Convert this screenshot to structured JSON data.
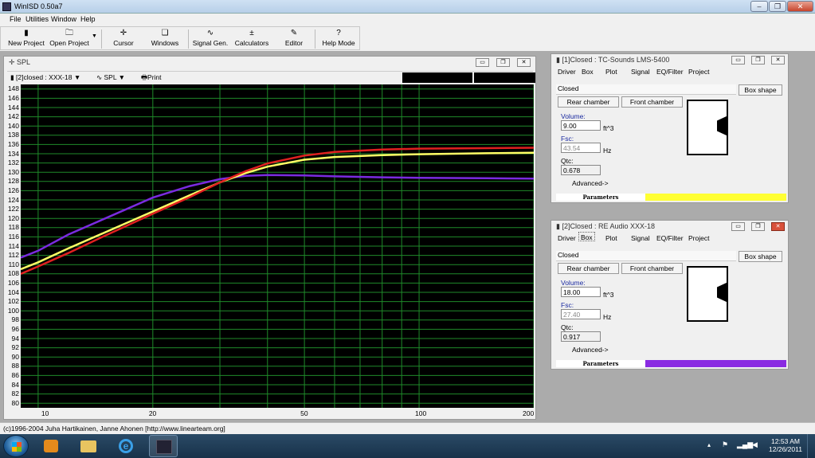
{
  "window": {
    "title": "WinISD 0.50a7"
  },
  "menu": [
    "File",
    "Utilities",
    "Window",
    "Help"
  ],
  "toolbar": [
    {
      "label": "New Project",
      "icon": "new-project-icon"
    },
    {
      "label": "Open Project",
      "icon": "open-folder-icon"
    },
    {
      "label": "Cursor",
      "icon": "cursor-icon"
    },
    {
      "label": "Windows",
      "icon": "windows-icon"
    },
    {
      "label": "Signal Gen.",
      "icon": "sine-wave-icon"
    },
    {
      "label": "Calculators",
      "icon": "calculator-icon"
    },
    {
      "label": "Editor",
      "icon": "editor-icon"
    },
    {
      "label": "Help Mode",
      "icon": "help-icon"
    }
  ],
  "spl_window": {
    "title": "SPL",
    "project_select": "[2]closed : XXX-18",
    "graph_select": "SPL",
    "print_label": "Print"
  },
  "chart_data": {
    "type": "line",
    "title": "",
    "xlabel": "",
    "ylabel": "",
    "x_scale": "log",
    "xlim": [
      9,
      200
    ],
    "ylim": [
      79,
      149
    ],
    "x_ticks": [
      10,
      20,
      50,
      100,
      200
    ],
    "y_ticks": [
      80,
      82,
      84,
      86,
      88,
      90,
      92,
      94,
      96,
      98,
      100,
      102,
      104,
      106,
      108,
      110,
      112,
      114,
      116,
      118,
      120,
      122,
      124,
      126,
      128,
      130,
      132,
      134,
      136,
      138,
      140,
      142,
      144,
      146,
      148
    ],
    "grid": true,
    "series": [
      {
        "color": "#7a2be0",
        "x": [
          9,
          10,
          12,
          15,
          20,
          25,
          30,
          35,
          40,
          50,
          60,
          80,
          100,
          150,
          200
        ],
        "y": [
          111.5,
          113,
          116.5,
          120,
          124.5,
          127,
          128.5,
          129.2,
          129.4,
          129.3,
          129.1,
          128.9,
          128.8,
          128.7,
          128.6
        ]
      },
      {
        "color": "#ffff66",
        "x": [
          9,
          10,
          12,
          15,
          20,
          25,
          30,
          35,
          40,
          50,
          60,
          80,
          100,
          150,
          200
        ],
        "y": [
          109,
          110.5,
          113.5,
          117,
          121.5,
          125,
          127.8,
          129.8,
          131.2,
          132.7,
          133.3,
          133.7,
          133.9,
          134.1,
          134.2
        ]
      },
      {
        "color": "#e02020",
        "x": [
          9,
          10,
          12,
          15,
          20,
          25,
          30,
          35,
          40,
          50,
          60,
          80,
          100,
          150,
          200
        ],
        "y": [
          108,
          109.6,
          112.5,
          116.3,
          121,
          124.6,
          127.8,
          130.2,
          131.9,
          133.6,
          134.4,
          134.9,
          135.1,
          135.2,
          135.3
        ]
      }
    ]
  },
  "panel1": {
    "title": "[1]Closed : TC-Sounds LMS-5400",
    "tabs": [
      "Driver",
      "Box",
      "Plot",
      "Signal",
      "EQ/Filter",
      "Project"
    ],
    "box_type": "Closed",
    "box_shape_label": "Box shape",
    "rear_chamber": "Rear chamber",
    "front_chamber": "Front chamber",
    "volume_label": "Volume:",
    "volume": "9.00",
    "volume_unit": "ft^3",
    "fsc_label": "Fsc:",
    "fsc": "43.54",
    "fsc_unit": "Hz",
    "qtc_label": "Qtc:",
    "qtc": "0.678",
    "advanced": "Advanced->",
    "params_label": "Parameters",
    "color": "#ffff33"
  },
  "panel2": {
    "title": "[2]Closed : RE Audio XXX-18",
    "tabs": [
      "Driver",
      "Box",
      "Plot",
      "Signal",
      "EQ/Filter",
      "Project"
    ],
    "box_type": "Closed",
    "box_shape_label": "Box shape",
    "rear_chamber": "Rear chamber",
    "front_chamber": "Front chamber",
    "volume_label": "Volume:",
    "volume": "18.00",
    "volume_unit": "ft^3",
    "fsc_label": "Fsc:",
    "fsc": "27.40",
    "fsc_unit": "Hz",
    "qtc_label": "Qtc:",
    "qtc": "0.917",
    "advanced": "Advanced->",
    "params_label": "Parameters",
    "color": "#8a2be2"
  },
  "statusbar": {
    "text": "(c)1996-2004 Juha Hartikainen, Janne Ahonen [http://www.linearteam.org]"
  },
  "taskbar": {
    "time": "12:53 AM",
    "date": "12/26/2011"
  }
}
